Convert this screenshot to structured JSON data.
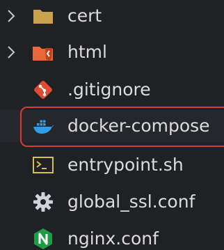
{
  "explorer": {
    "items": [
      {
        "label": "cert",
        "kind": "folder",
        "icon": "folder-icon",
        "expandable": true
      },
      {
        "label": "html",
        "kind": "folder",
        "icon": "html-folder-icon",
        "expandable": true
      },
      {
        "label": ".gitignore",
        "kind": "file",
        "icon": "git-icon",
        "expandable": false
      },
      {
        "label": "docker-compose",
        "kind": "file",
        "icon": "docker-icon",
        "expandable": false,
        "selected": true
      },
      {
        "label": "entrypoint.sh",
        "kind": "file",
        "icon": "terminal-icon",
        "expandable": false
      },
      {
        "label": "global_ssl.conf",
        "kind": "file",
        "icon": "gear-icon",
        "expandable": false
      },
      {
        "label": "nginx.conf",
        "kind": "file",
        "icon": "nginx-icon",
        "expandable": false
      }
    ]
  },
  "colors": {
    "background": "#1f2125",
    "text": "#dcdcdc",
    "selection_outline": "#e0392f",
    "folder": "#c9a24f",
    "html_folder": "#e9683a",
    "git": "#e24b33",
    "docker": "#2f9ee8",
    "terminal": "#d6c24a",
    "gear": "#cfd3dc",
    "nginx": "#1e9b45"
  }
}
